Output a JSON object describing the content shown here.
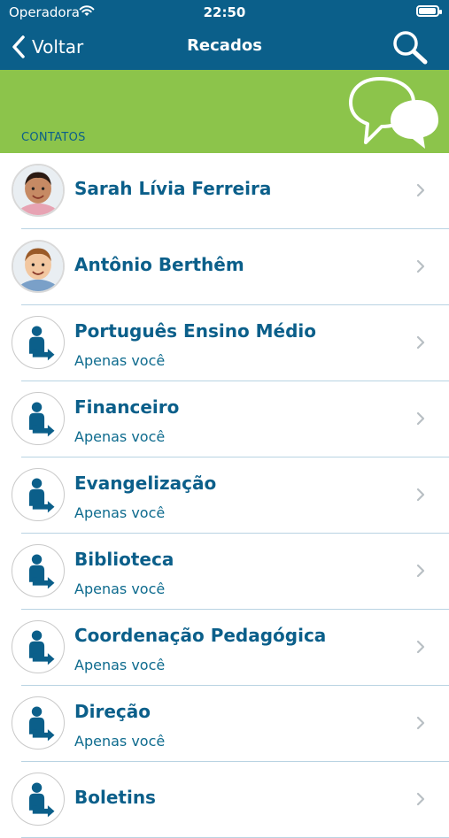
{
  "status_bar": {
    "carrier": "Operadora",
    "time": "22:50"
  },
  "nav": {
    "back_label": "Voltar",
    "title": "Recados"
  },
  "banner": {
    "section_label": "CONTATOS"
  },
  "colors": {
    "nav_blue": "#0b5f8a",
    "banner_green": "#8cc44b",
    "text_blue": "#0b5f8a"
  },
  "contacts": [
    {
      "name": "Sarah Lívia Ferreira",
      "subtitle": "",
      "avatar": "child-photo-1"
    },
    {
      "name": "Antônio Berthêm",
      "subtitle": "",
      "avatar": "child-photo-2"
    },
    {
      "name": "Português Ensino Médio",
      "subtitle": "Apenas você",
      "avatar": "group-icon"
    },
    {
      "name": "Financeiro",
      "subtitle": "Apenas você",
      "avatar": "group-icon"
    },
    {
      "name": "Evangelização",
      "subtitle": "Apenas você",
      "avatar": "group-icon"
    },
    {
      "name": "Biblioteca",
      "subtitle": "Apenas você",
      "avatar": "group-icon"
    },
    {
      "name": "Coordenação Pedagógica",
      "subtitle": "Apenas você",
      "avatar": "group-icon"
    },
    {
      "name": "Direção",
      "subtitle": "Apenas você",
      "avatar": "group-icon"
    },
    {
      "name": "Boletins",
      "subtitle": "",
      "avatar": "group-icon"
    }
  ]
}
